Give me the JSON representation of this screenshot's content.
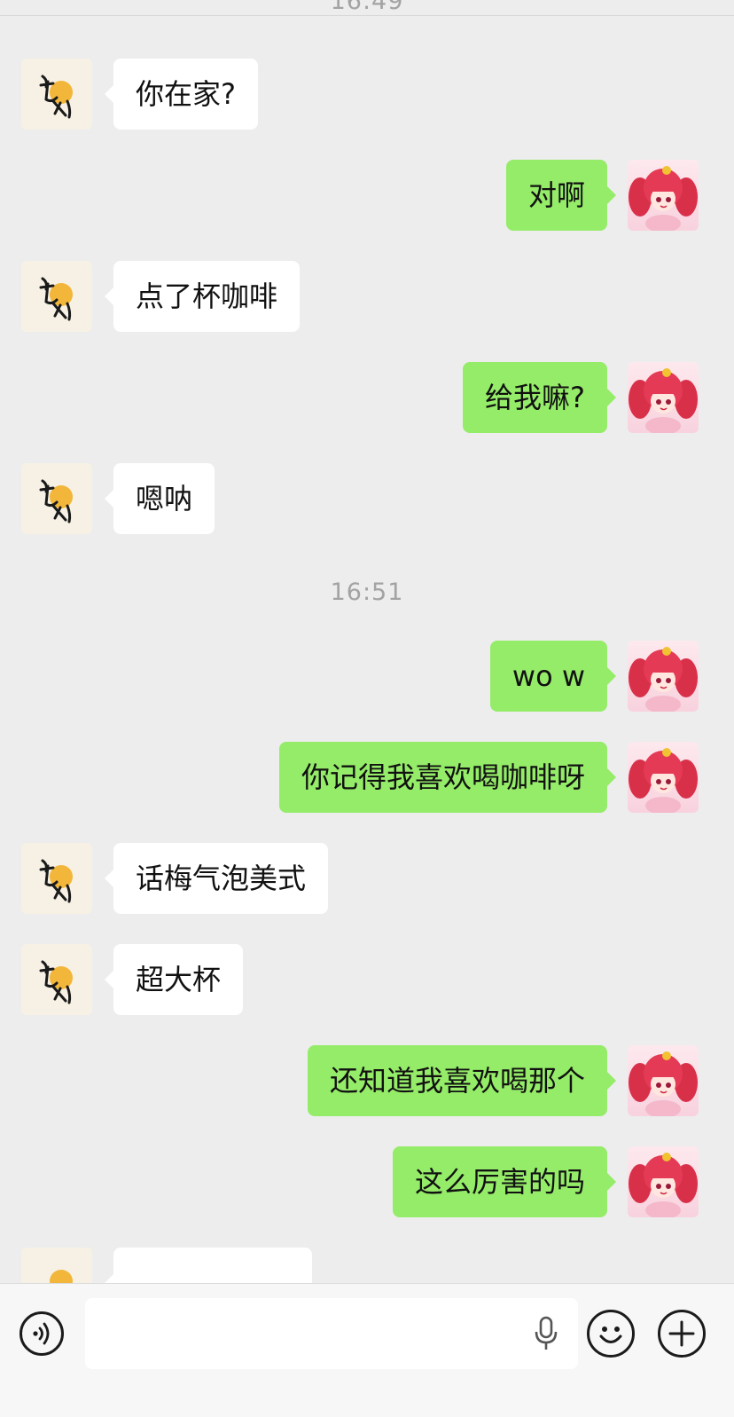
{
  "timestamps": {
    "top": "16:49",
    "mid": "16:51"
  },
  "messages": [
    {
      "from": "peer",
      "text": "你在家?"
    },
    {
      "from": "me",
      "text": "对啊"
    },
    {
      "from": "peer",
      "text": "点了杯咖啡"
    },
    {
      "from": "me",
      "text": "给我嘛?"
    },
    {
      "from": "peer",
      "text": "嗯呐"
    },
    {
      "from": "me",
      "text": "wo w"
    },
    {
      "from": "me",
      "text": "你记得我喜欢喝咖啡呀"
    },
    {
      "from": "peer",
      "text": "话梅气泡美式"
    },
    {
      "from": "peer",
      "text": "超大杯"
    },
    {
      "from": "me",
      "text": "还知道我喜欢喝那个"
    },
    {
      "from": "me",
      "text": "这么厉害的吗"
    }
  ],
  "input_bar": {
    "placeholder": "",
    "icons": [
      "voice-icon",
      "microphone-icon",
      "emoji-icon",
      "plus-icon"
    ]
  },
  "colors": {
    "background": "#ededed",
    "my_bubble": "#95ec69",
    "peer_bubble": "#ffffff",
    "timestamp": "#a3a3a3"
  }
}
